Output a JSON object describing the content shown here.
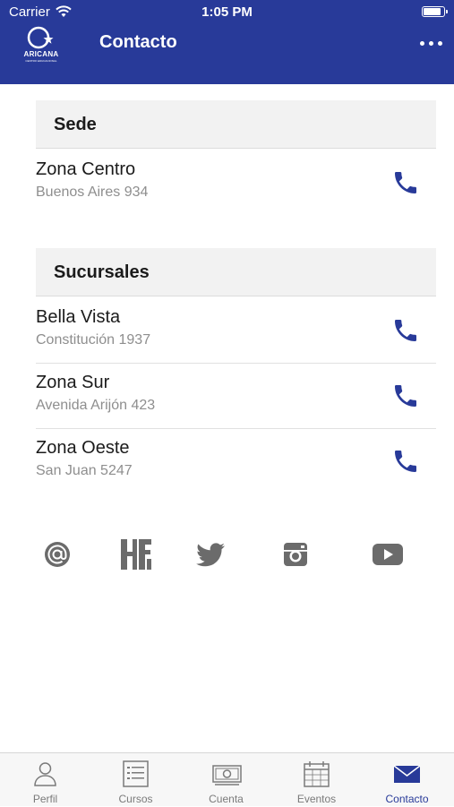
{
  "status_bar": {
    "carrier": "Carrier",
    "time": "1:05 PM",
    "battery_level": 0.95
  },
  "header": {
    "title": "Contacto",
    "logo_text": "ARICANA",
    "logo_subtext": "CENTRO EDUCACIONAL"
  },
  "sections": [
    {
      "title": "Sede",
      "items": [
        {
          "name": "Zona Centro",
          "address": "Buenos Aires 934"
        }
      ]
    },
    {
      "title": "Sucursales",
      "items": [
        {
          "name": "Bella Vista",
          "address": "Constitución 1937"
        },
        {
          "name": "Zona Sur",
          "address": "Avenida Arijón 423"
        },
        {
          "name": "Zona Oeste",
          "address": "San Juan 5247"
        }
      ]
    }
  ],
  "social": [
    "email-icon",
    "hfl-icon",
    "twitter-icon",
    "instagram-icon",
    "youtube-icon"
  ],
  "tabs": [
    {
      "label": "Perfil",
      "icon": "person-icon",
      "active": false
    },
    {
      "label": "Cursos",
      "icon": "list-icon",
      "active": false
    },
    {
      "label": "Cuenta",
      "icon": "money-icon",
      "active": false
    },
    {
      "label": "Eventos",
      "icon": "calendar-icon",
      "active": false
    },
    {
      "label": "Contacto",
      "icon": "mail-icon",
      "active": true
    }
  ],
  "colors": {
    "primary": "#283a99",
    "icon_gray": "#6b6b6b",
    "tab_gray": "#7a7a7a"
  }
}
